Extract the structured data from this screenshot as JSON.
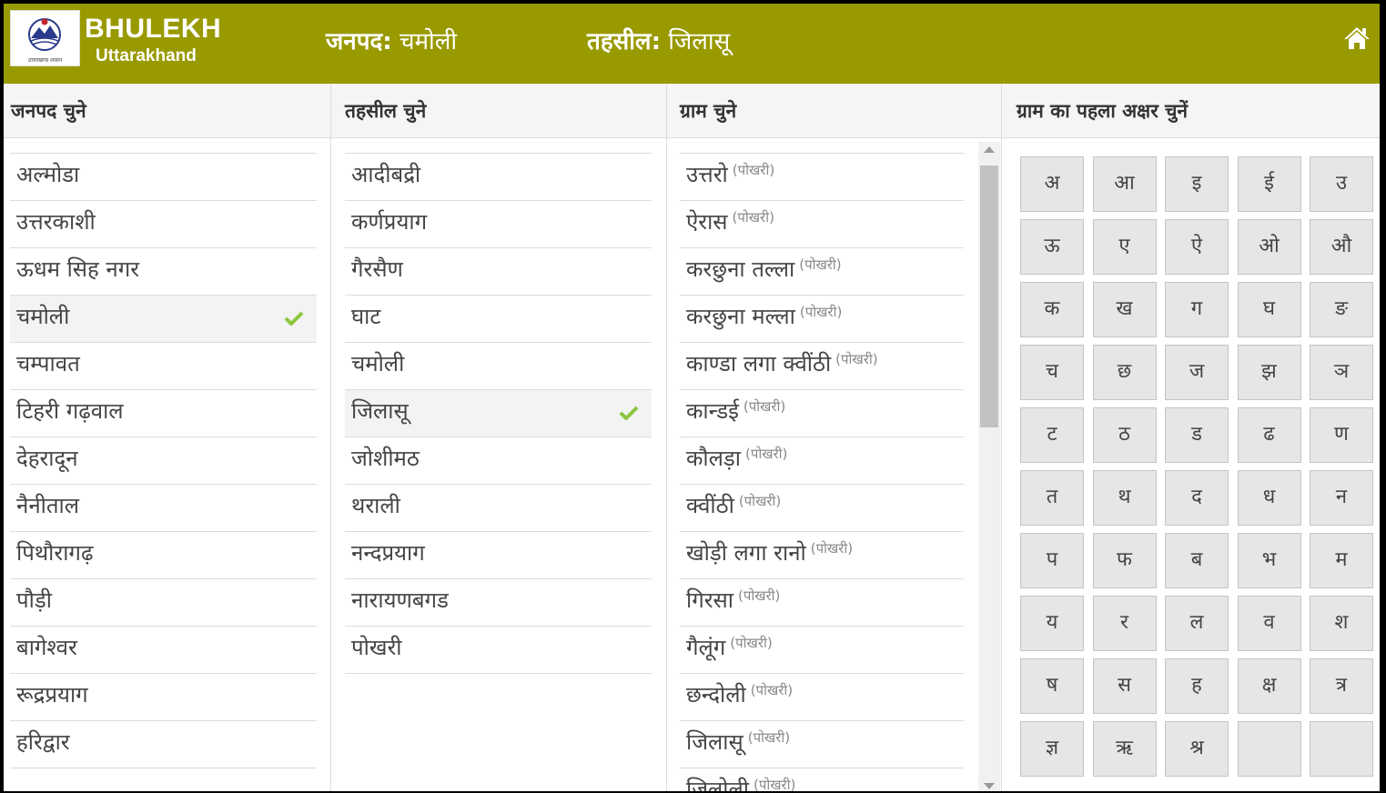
{
  "header": {
    "brand_title": "BHULEKH",
    "brand_subtitle": "Uttarakhand",
    "logo_caption": "उत्तराखण्ड शासन",
    "district_label": "जनपद:",
    "district_value": "चमोली",
    "tehsil_label": "तहसील:",
    "tehsil_value": "जिलासू",
    "home_icon": "home-icon"
  },
  "districts": {
    "heading": "जनपद चुने",
    "items": [
      "अल्मोडा",
      "उत्तरकाशी",
      "ऊधम सिह नगर",
      "चमोली",
      "चम्पावत",
      "टिहरी गढ़वाल",
      "देहरादून",
      "नैनीताल",
      "पिथौरागढ़",
      "पौड़ी",
      "बागेश्वर",
      "रूद्रप्रयाग",
      "हरिद्वार"
    ],
    "selected_index": 3
  },
  "tehsils": {
    "heading": "तहसील चुने",
    "items": [
      "आदीबद्री",
      "कर्णप्रयाग",
      "गैरसैण",
      "घाट",
      "चमोली",
      "जिलासू",
      "जोशीमठ",
      "थराली",
      "नन्दप्रयाग",
      "नारायणबगड",
      "पोखरी"
    ],
    "selected_index": 5
  },
  "villages": {
    "heading": "ग्राम चुने",
    "items": [
      {
        "name": "उत्तरो",
        "tag": "(पोखरी)"
      },
      {
        "name": "ऐरास",
        "tag": "(पोखरी)"
      },
      {
        "name": "करछुना तल्ला",
        "tag": "(पोखरी)"
      },
      {
        "name": "करछुना मल्ला",
        "tag": "(पोखरी)"
      },
      {
        "name": "काण्डा लगा क्वींठी",
        "tag": "(पोखरी)"
      },
      {
        "name": "कान्डई",
        "tag": "(पोखरी)"
      },
      {
        "name": "कौलड़ा",
        "tag": "(पोखरी)"
      },
      {
        "name": "क्वींठी",
        "tag": "(पोखरी)"
      },
      {
        "name": "खोड़ी लगा रानो",
        "tag": "(पोखरी)"
      },
      {
        "name": "गिरसा",
        "tag": "(पोखरी)"
      },
      {
        "name": "गैलूंग",
        "tag": "(पोखरी)"
      },
      {
        "name": "छन्दोली",
        "tag": "(पोखरी)"
      },
      {
        "name": "जिलासू",
        "tag": "(पोखरी)"
      },
      {
        "name": "जिलोली",
        "tag": "(पोखरी)"
      }
    ]
  },
  "letters": {
    "heading": "ग्राम का पहला अक्षर चुनें",
    "keys": [
      "अ",
      "आ",
      "इ",
      "ई",
      "उ",
      "ऊ",
      "ए",
      "ऐ",
      "ओ",
      "औ",
      "क",
      "ख",
      "ग",
      "घ",
      "ङ",
      "च",
      "छ",
      "ज",
      "झ",
      "ञ",
      "ट",
      "ठ",
      "ड",
      "ढ",
      "ण",
      "त",
      "थ",
      "द",
      "ध",
      "न",
      "प",
      "फ",
      "ब",
      "भ",
      "म",
      "य",
      "र",
      "ल",
      "व",
      "श",
      "ष",
      "स",
      "ह",
      "क्ष",
      "त्र",
      "ज्ञ",
      "ऋ",
      "श्र",
      "",
      ""
    ]
  },
  "colors": {
    "header_bg": "#999900",
    "check": "#8cc63f"
  }
}
